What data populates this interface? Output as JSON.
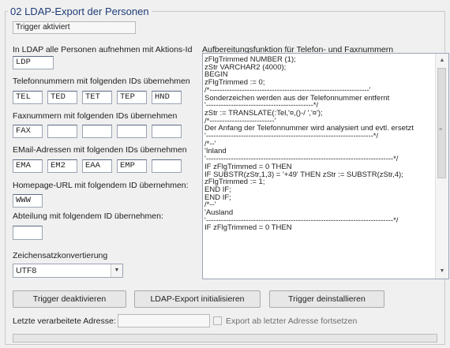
{
  "group": {
    "title": "02  LDAP-Export der Personen"
  },
  "status": {
    "text": "Trigger aktiviert"
  },
  "labels": {
    "ldap_all": "In LDAP alle Personen aufnehmen mit Aktions-Id",
    "phone": "Telefonnummern mit folgenden IDs übernehmen",
    "fax": "Faxnummern mit folgenden IDs übernehmen",
    "email": "EMail-Adressen mit folgenden IDs übernehmen",
    "homepage": "Homepage-URL mit folgendem ID übernehmen:",
    "department": "Abteilung mit folgendem ID übernehmen:",
    "charset": "Zeichensatzkonvertierung",
    "function": "Aufbereitungsfunktion für Telefon- und Faxnummern",
    "last_address": "Letzte verarbeitete Adresse:",
    "continue_checkbox": "Export ab letzter Adresse fortsetzen"
  },
  "fields": {
    "action_id": "LDP",
    "phone_ids": [
      "TEL",
      "TED",
      "TET",
      "TEP",
      "HND"
    ],
    "fax_ids": [
      "FAX",
      "",
      "",
      "",
      ""
    ],
    "email_ids": [
      "EMA",
      "EM2",
      "EAA",
      "EMP",
      ""
    ],
    "homepage_id": "WWW",
    "department_id": "",
    "charset_selected": "UTF8",
    "last_address": ""
  },
  "code_lines": [
    "zFlgTrimmed NUMBER (1);",
    "zStr VARCHAR2 (4000);",
    "BEGIN",
    "zFlgTrimmed := 0;",
    "/*----------------------------------------------------------------'",
    "Sonderzeichen werden aus der Telefonnummer entfernt",
    "'-------------------------------------------*/",
    "zStr := TRANSLATE(:Tel,'¤,()-/ ','¤');",
    "/*--------------------------'",
    "Der Anfang der Telefonnummer wird analysiert und evtl. ersetzt",
    "'-------------------------------------------------------------------*/",
    "/*--'",
    "'Inland",
    "'---------------------------------------------------------------------------*/",
    "IF zFlgTrimmed = 0 THEN",
    "IF SUBSTR(zStr,1,3) = '+49' THEN zStr := SUBSTR(zStr,4);",
    "zFlgTrimmed := 1;",
    "END IF;",
    "END IF;",
    "/*--'",
    "'Ausland",
    "'---------------------------------------------------------------------------*/",
    "IF zFlgTrimmed = 0 THEN"
  ],
  "buttons": {
    "deactivate": "Trigger deaktivieren",
    "init": "LDAP-Export initialisieren",
    "uninstall": "Trigger deinstallieren"
  },
  "icons": {
    "dropdown": "chevron-down-icon",
    "scroll_up": "scroll-up-icon",
    "scroll_down": "scroll-down-icon",
    "scroll_grip": "scroll-grip-icon"
  }
}
